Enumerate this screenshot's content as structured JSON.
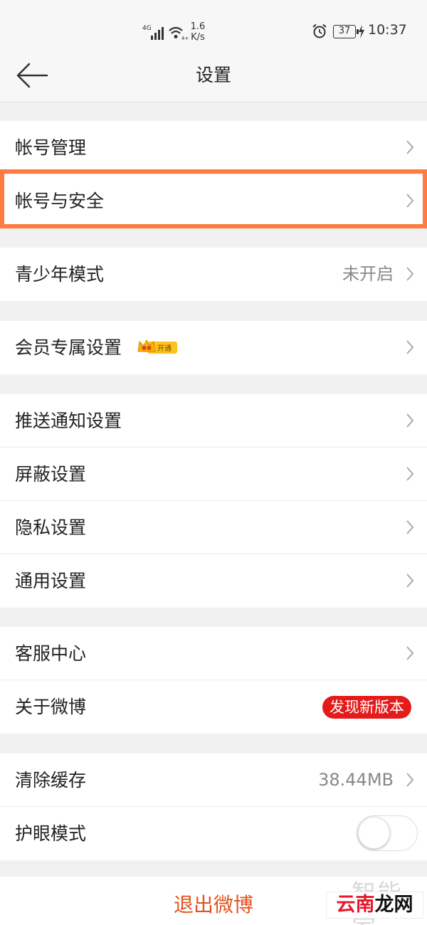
{
  "status_bar": {
    "network_type": "4G",
    "speed_value": "1.6",
    "speed_unit": "K/s",
    "battery": "37",
    "time": "10:37"
  },
  "header": {
    "title": "设置"
  },
  "groups": [
    {
      "items": [
        {
          "label": "帐号管理"
        },
        {
          "label": "帐号与安全"
        }
      ]
    },
    {
      "items": [
        {
          "label": "青少年模式",
          "value": "未开启"
        }
      ]
    },
    {
      "items": [
        {
          "label": "会员专属设置",
          "badge": "开通"
        }
      ]
    },
    {
      "items": [
        {
          "label": "推送通知设置"
        },
        {
          "label": "屏蔽设置"
        },
        {
          "label": "隐私设置"
        },
        {
          "label": "通用设置"
        }
      ]
    },
    {
      "items": [
        {
          "label": "客服中心"
        },
        {
          "label": "关于微博",
          "badge": "发现新版本"
        }
      ]
    },
    {
      "items": [
        {
          "label": "清除缓存",
          "value": "38.44MB"
        },
        {
          "label": "护眼模式",
          "toggle_on": false
        }
      ]
    }
  ],
  "logout": {
    "label": "退出微博"
  },
  "watermark": {
    "ghost": "智能家",
    "red": "云南",
    "black": "龙网"
  },
  "colors": {
    "accent": "#e4531e",
    "highlight_border": "#ff7b40",
    "new_badge": "#e51a1a",
    "vip_gold": "#f5b400"
  }
}
